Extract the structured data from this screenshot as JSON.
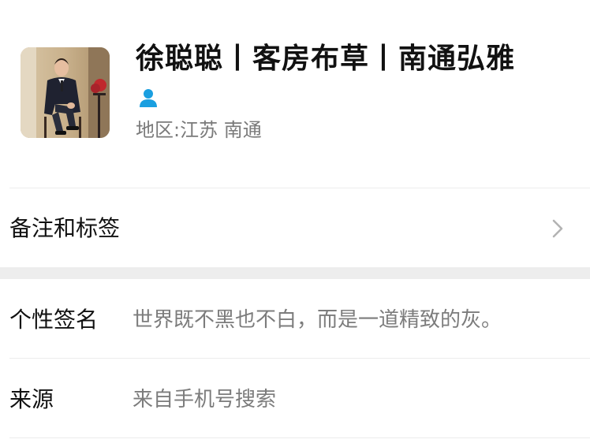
{
  "profile": {
    "nickname": "徐聪聪丨客房布草丨南通弘雅",
    "region_label": "地区:",
    "region_value": "江苏 南通",
    "gender_icon": "person-icon",
    "accent_color": "#1a9fe0"
  },
  "remark": {
    "label": "备注和标签",
    "chevron_icon": "chevron-right-icon"
  },
  "signature": {
    "label": "个性签名",
    "value": "世界既不黑也不白，而是一道精致的灰。"
  },
  "source": {
    "label": "来源",
    "value": "来自手机号搜索"
  }
}
